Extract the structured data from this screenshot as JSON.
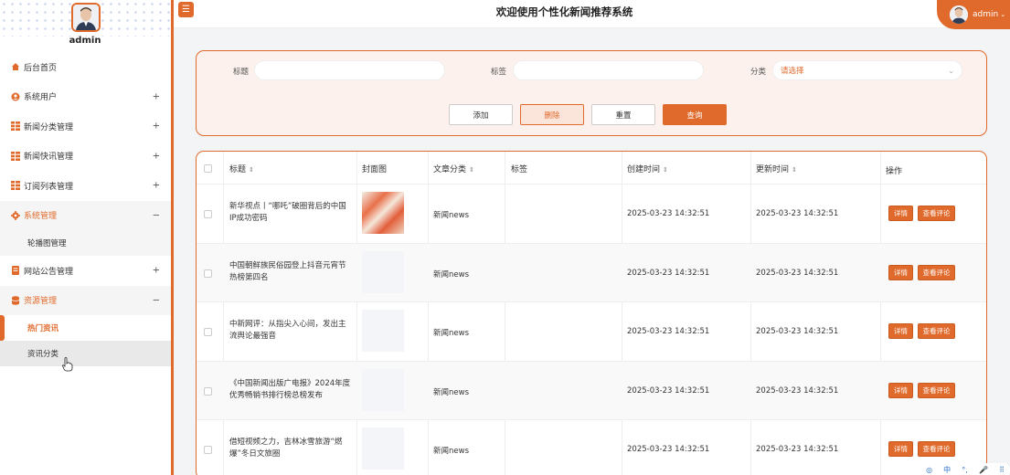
{
  "sidebar": {
    "username": "admin",
    "menu": [
      {
        "label": "后台首页",
        "icon": "home-icon",
        "expand": ""
      },
      {
        "label": "系统用户",
        "icon": "user-icon",
        "expand": "+"
      },
      {
        "label": "新闻分类管理",
        "icon": "grid-icon",
        "expand": "+"
      },
      {
        "label": "新闻快讯管理",
        "icon": "grid-icon",
        "expand": "+"
      },
      {
        "label": "订阅列表管理",
        "icon": "grid-icon",
        "expand": "+"
      },
      {
        "label": "系统管理",
        "icon": "gear-icon",
        "expand": "−"
      },
      {
        "label": "轮播图管理",
        "sub": true
      },
      {
        "label": "网站公告管理",
        "icon": "doc-icon",
        "expand": "+"
      },
      {
        "label": "资源管理",
        "icon": "database-icon",
        "expand": "−"
      },
      {
        "label": "热门资讯",
        "sub": true
      },
      {
        "label": "资讯分类",
        "sub": true
      }
    ]
  },
  "header": {
    "title": "欢迎使用个性化新闻推荐系统",
    "user": "admin",
    "menu_icon": "hamburger-icon"
  },
  "search": {
    "title_label": "标题",
    "tag_label": "标签",
    "category_label": "分类",
    "category_placeholder": "请选择",
    "buttons": {
      "add": "添加",
      "delete": "删除",
      "reset": "重置",
      "query": "查询"
    }
  },
  "table": {
    "headers": {
      "title": "标题",
      "cover": "封面图",
      "category": "文章分类",
      "tag": "标签",
      "created": "创建时间",
      "updated": "更新时间",
      "action": "操作"
    },
    "rows": [
      {
        "title": "新华视点丨“哪吒”破圈背后的中国IP成功密码",
        "category": "新闻news",
        "created": "2025-03-23 14:32:51",
        "updated": "2025-03-23 14:32:51"
      },
      {
        "title": "中国朝鲜族民俗园登上抖音元宵节热榜第四名",
        "category": "新闻news",
        "created": "2025-03-23 14:32:51",
        "updated": "2025-03-23 14:32:51"
      },
      {
        "title": "中新网评：从指尖入心间，发出主流舆论最强音",
        "category": "新闻news",
        "created": "2025-03-23 14:32:51",
        "updated": "2025-03-23 14:32:51"
      },
      {
        "title": "《中国新闻出版广电报》2024年度优秀畅销书排行榜总榜发布",
        "category": "新闻news",
        "created": "2025-03-23 14:32:51",
        "updated": "2025-03-23 14:32:51"
      },
      {
        "title": "借短视频之力，吉林冰雪旅游“燃爆”冬日文旅圈",
        "category": "新闻news",
        "created": "2025-03-23 14:32:51",
        "updated": "2025-03-23 14:32:51"
      }
    ],
    "row_buttons": {
      "detail": "详情",
      "comments": "查看评论"
    }
  },
  "floatbar": {
    "label": "中"
  },
  "colors": {
    "accent": "#e06a2c",
    "panel": "#fcf1ec"
  }
}
